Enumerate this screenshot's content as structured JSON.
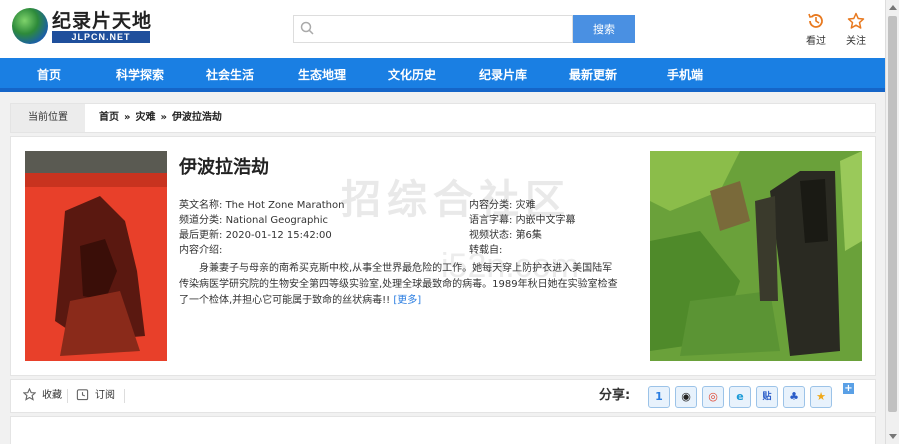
{
  "header": {
    "logo_title": "纪录片天地",
    "logo_subtitle": "JLPCN.NET",
    "search_placeholder": "",
    "search_button": "搜索",
    "history_label": "看过",
    "favorite_label": "关注"
  },
  "nav": {
    "items": [
      "首页",
      "科学探索",
      "社会生活",
      "生态地理",
      "文化历史",
      "纪录片库",
      "最新更新",
      "手机端"
    ]
  },
  "breadcrumb": {
    "label": "当前位置",
    "items": [
      "首页",
      "灾难",
      "伊波拉浩劫"
    ],
    "separator": "»"
  },
  "detail": {
    "title": "伊波拉浩劫",
    "english_name_label": "英文名称:",
    "english_name": "The Hot Zone Marathon",
    "channel_label": "频道分类:",
    "channel": "National Geographic",
    "updated_label": "最后更新:",
    "updated": "2020-01-12 15:42:00",
    "intro_label": "内容介绍:",
    "category_label": "内容分类:",
    "category": "灾难",
    "subtitle_label": "语言字幕:",
    "subtitle": "内嵌中文字幕",
    "status_label": "视频状态:",
    "status": "第6集",
    "source_label": "转载自:",
    "source": "",
    "description": "身兼妻子与母亲的南希买克斯中校,从事全世界最危险的工作。她每天穿上防护衣进入美国陆军传染病医学研究院的生物安全第四等级实验室,处理全球最致命的病毒。1989年秋日她在实验室检查了一个检体,并担心它可能属于致命的丝状病毒!!",
    "more_label": "[更多]"
  },
  "share_bar": {
    "collect_label": "收藏",
    "subscribe_label": "订阅",
    "share_label": "分享:",
    "share_icons": [
      "share-1-icon",
      "qq-icon",
      "weibo-icon",
      "tencent-weibo-icon",
      "tieba-icon",
      "baidu-icon",
      "qzone-star-icon"
    ]
  },
  "colors": {
    "nav_blue": "#1a7fe3",
    "search_button": "#4a90e2",
    "accent_orange": "#e8791f"
  }
}
